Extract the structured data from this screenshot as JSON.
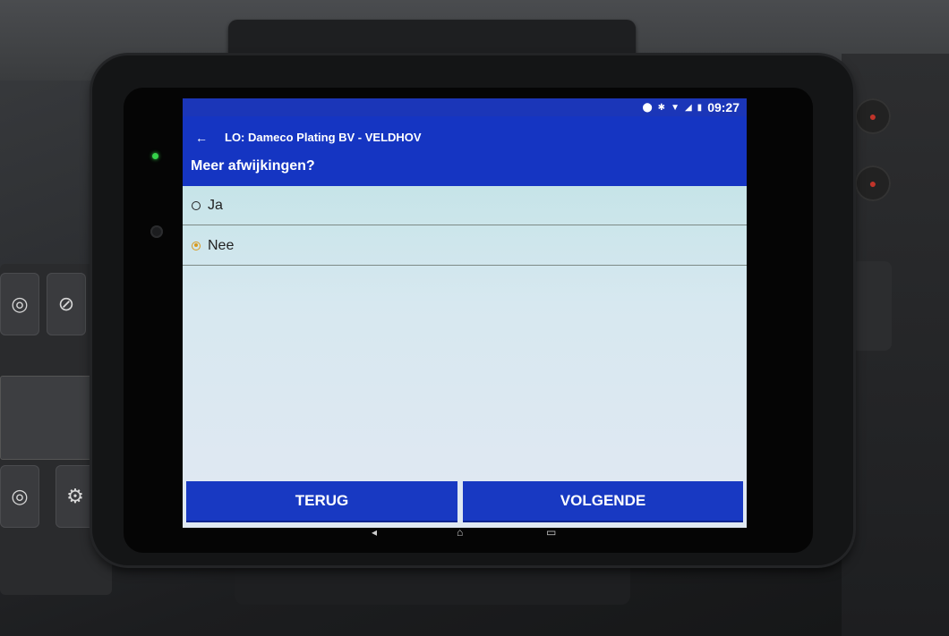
{
  "status_bar": {
    "time": "09:27",
    "icons": [
      "location-icon",
      "bluetooth-icon",
      "wifi-icon",
      "signal-icon",
      "battery-icon"
    ]
  },
  "app_bar": {
    "back_icon": "arrow-left-icon",
    "title": "LO: Dameco Plating BV - VELDHOV",
    "question": "Meer afwijkingen?"
  },
  "options": [
    {
      "label": "Ja",
      "selected": false
    },
    {
      "label": "Nee",
      "selected": true
    }
  ],
  "buttons": {
    "back_label": "TERUG",
    "next_label": "VOLGENDE"
  },
  "colors": {
    "primary": "#1535c2",
    "radio_selected": "#d89a1e",
    "led": "#35d24a"
  },
  "android_nav": [
    "back-icon",
    "home-icon",
    "recents-icon"
  ]
}
